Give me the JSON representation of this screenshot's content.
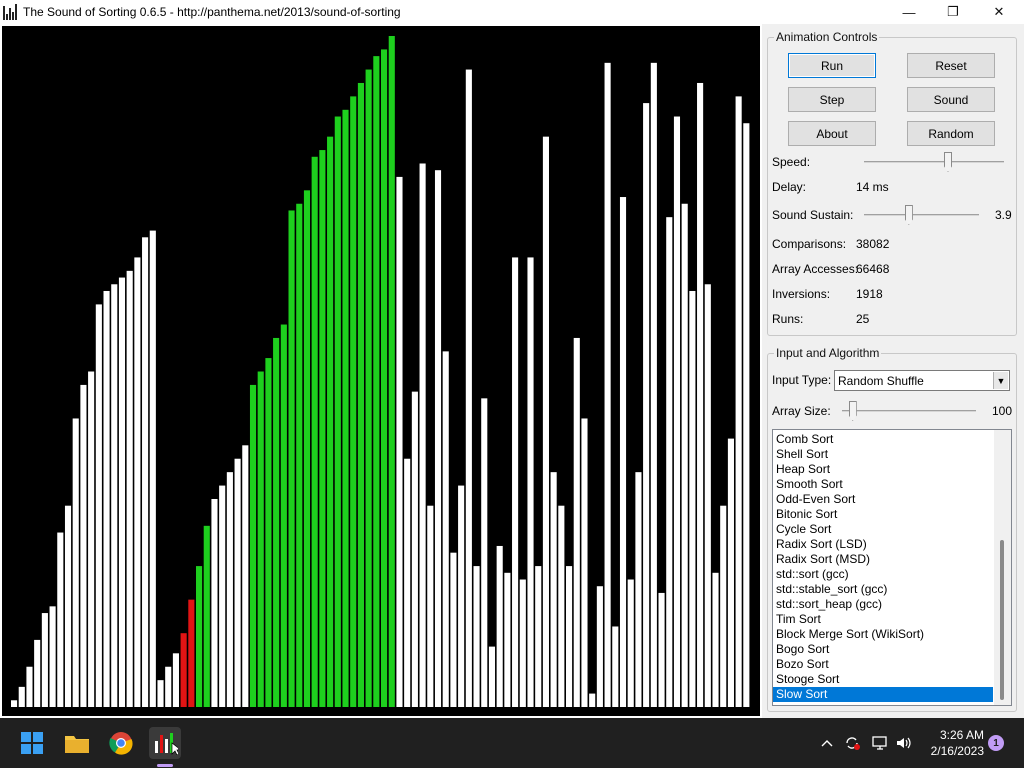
{
  "window": {
    "title": "The Sound of Sorting 0.6.5 - http://panthema.net/2013/sound-of-sorting",
    "minimize": "—",
    "maximize": "❐",
    "close": "✕"
  },
  "visualization": {
    "bar_colors": {
      "white": "#ffffff",
      "green": "#1ed01e",
      "red": "#e11414",
      "background": "#000000"
    },
    "bars": [
      {
        "v": 1,
        "c": "white"
      },
      {
        "v": 3,
        "c": "white"
      },
      {
        "v": 6,
        "c": "white"
      },
      {
        "v": 10,
        "c": "white"
      },
      {
        "v": 14,
        "c": "white"
      },
      {
        "v": 15,
        "c": "white"
      },
      {
        "v": 26,
        "c": "white"
      },
      {
        "v": 30,
        "c": "white"
      },
      {
        "v": 43,
        "c": "white"
      },
      {
        "v": 48,
        "c": "white"
      },
      {
        "v": 50,
        "c": "white"
      },
      {
        "v": 60,
        "c": "white"
      },
      {
        "v": 62,
        "c": "white"
      },
      {
        "v": 63,
        "c": "white"
      },
      {
        "v": 64,
        "c": "white"
      },
      {
        "v": 65,
        "c": "white"
      },
      {
        "v": 67,
        "c": "white"
      },
      {
        "v": 70,
        "c": "white"
      },
      {
        "v": 71,
        "c": "white"
      },
      {
        "v": 4,
        "c": "white"
      },
      {
        "v": 6,
        "c": "white"
      },
      {
        "v": 8,
        "c": "white"
      },
      {
        "v": 11,
        "c": "red"
      },
      {
        "v": 16,
        "c": "red"
      },
      {
        "v": 21,
        "c": "green"
      },
      {
        "v": 27,
        "c": "green"
      },
      {
        "v": 31,
        "c": "white"
      },
      {
        "v": 33,
        "c": "white"
      },
      {
        "v": 35,
        "c": "white"
      },
      {
        "v": 37,
        "c": "white"
      },
      {
        "v": 39,
        "c": "white"
      },
      {
        "v": 48,
        "c": "green"
      },
      {
        "v": 50,
        "c": "green"
      },
      {
        "v": 52,
        "c": "green"
      },
      {
        "v": 55,
        "c": "green"
      },
      {
        "v": 57,
        "c": "green"
      },
      {
        "v": 74,
        "c": "green"
      },
      {
        "v": 75,
        "c": "green"
      },
      {
        "v": 77,
        "c": "green"
      },
      {
        "v": 82,
        "c": "green"
      },
      {
        "v": 83,
        "c": "green"
      },
      {
        "v": 85,
        "c": "green"
      },
      {
        "v": 88,
        "c": "green"
      },
      {
        "v": 89,
        "c": "green"
      },
      {
        "v": 91,
        "c": "green"
      },
      {
        "v": 93,
        "c": "green"
      },
      {
        "v": 95,
        "c": "green"
      },
      {
        "v": 97,
        "c": "green"
      },
      {
        "v": 98,
        "c": "green"
      },
      {
        "v": 100,
        "c": "green"
      },
      {
        "v": 79,
        "c": "white"
      },
      {
        "v": 37,
        "c": "white"
      },
      {
        "v": 47,
        "c": "white"
      },
      {
        "v": 81,
        "c": "white"
      },
      {
        "v": 30,
        "c": "white"
      },
      {
        "v": 80,
        "c": "white"
      },
      {
        "v": 53,
        "c": "white"
      },
      {
        "v": 23,
        "c": "white"
      },
      {
        "v": 33,
        "c": "white"
      },
      {
        "v": 95,
        "c": "white"
      },
      {
        "v": 21,
        "c": "white"
      },
      {
        "v": 46,
        "c": "white"
      },
      {
        "v": 9,
        "c": "white"
      },
      {
        "v": 24,
        "c": "white"
      },
      {
        "v": 20,
        "c": "white"
      },
      {
        "v": 67,
        "c": "white"
      },
      {
        "v": 19,
        "c": "white"
      },
      {
        "v": 67,
        "c": "white"
      },
      {
        "v": 21,
        "c": "white"
      },
      {
        "v": 85,
        "c": "white"
      },
      {
        "v": 35,
        "c": "white"
      },
      {
        "v": 30,
        "c": "white"
      },
      {
        "v": 21,
        "c": "white"
      },
      {
        "v": 55,
        "c": "white"
      },
      {
        "v": 43,
        "c": "white"
      },
      {
        "v": 2,
        "c": "white"
      },
      {
        "v": 18,
        "c": "white"
      },
      {
        "v": 96,
        "c": "white"
      },
      {
        "v": 12,
        "c": "white"
      },
      {
        "v": 76,
        "c": "white"
      },
      {
        "v": 19,
        "c": "white"
      },
      {
        "v": 35,
        "c": "white"
      },
      {
        "v": 90,
        "c": "white"
      },
      {
        "v": 96,
        "c": "white"
      },
      {
        "v": 17,
        "c": "white"
      },
      {
        "v": 73,
        "c": "white"
      },
      {
        "v": 88,
        "c": "white"
      },
      {
        "v": 75,
        "c": "white"
      },
      {
        "v": 62,
        "c": "white"
      },
      {
        "v": 93,
        "c": "white"
      },
      {
        "v": 63,
        "c": "white"
      },
      {
        "v": 20,
        "c": "white"
      },
      {
        "v": 30,
        "c": "white"
      },
      {
        "v": 40,
        "c": "white"
      },
      {
        "v": 91,
        "c": "white"
      },
      {
        "v": 87,
        "c": "white"
      }
    ]
  },
  "animation_controls": {
    "legend": "Animation Controls",
    "run": "Run",
    "reset": "Reset",
    "step": "Step",
    "sound": "Sound",
    "about": "About",
    "random": "Random",
    "speed_label": "Speed:",
    "speed_level": 0.6,
    "delay_label": "Delay:",
    "delay_value": "14 ms",
    "sustain_label": "Sound Sustain:",
    "sustain_level": 0.39,
    "sustain_value": "3.9",
    "comparisons_label": "Comparisons:",
    "comparisons_value": "38082",
    "accesses_label": "Array Accesses:",
    "accesses_value": "66468",
    "inversions_label": "Inversions:",
    "inversions_value": "1918",
    "runs_label": "Runs:",
    "runs_value": "25"
  },
  "input_algorithm": {
    "legend": "Input and Algorithm",
    "input_type_label": "Input Type:",
    "input_type_value": "Random Shuffle",
    "array_size_label": "Array Size:",
    "array_size_level": 0.08,
    "array_size_value": "100",
    "algorithms": [
      "Comb Sort",
      "Shell Sort",
      "Heap Sort",
      "Smooth Sort",
      "Odd-Even Sort",
      "Bitonic Sort",
      "Cycle Sort",
      "Radix Sort (LSD)",
      "Radix Sort (MSD)",
      "std::sort (gcc)",
      "std::stable_sort (gcc)",
      "std::sort_heap (gcc)",
      "Tim Sort",
      "Block Merge Sort (WikiSort)",
      "Bogo Sort",
      "Bozo Sort",
      "Stooge Sort",
      "Slow Sort"
    ],
    "selected_index": 17
  },
  "taskbar": {
    "time": "3:26 AM",
    "date": "2/16/2023",
    "notification_count": "1",
    "accent": "#0078d4"
  }
}
